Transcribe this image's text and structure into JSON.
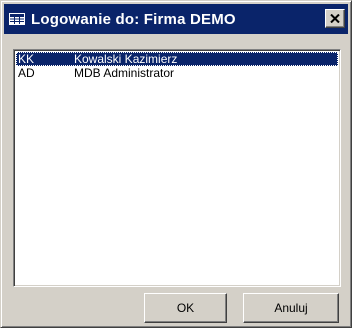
{
  "window": {
    "title": "Logowanie do: Firma DEMO",
    "close_symbol": "✕"
  },
  "users": [
    {
      "code": "KK",
      "name": "Kowalski Kazimierz",
      "selected": true
    },
    {
      "code": "AD",
      "name": "MDB Administrator",
      "selected": false
    }
  ],
  "buttons": {
    "ok_label": "OK",
    "cancel_label": "Anuluj"
  },
  "icons": {
    "title_icon": "table-icon",
    "close_icon": "close-icon"
  },
  "colors": {
    "titlebar": "#0a246a",
    "face": "#d4d0c8",
    "selection": "#0a246a"
  }
}
